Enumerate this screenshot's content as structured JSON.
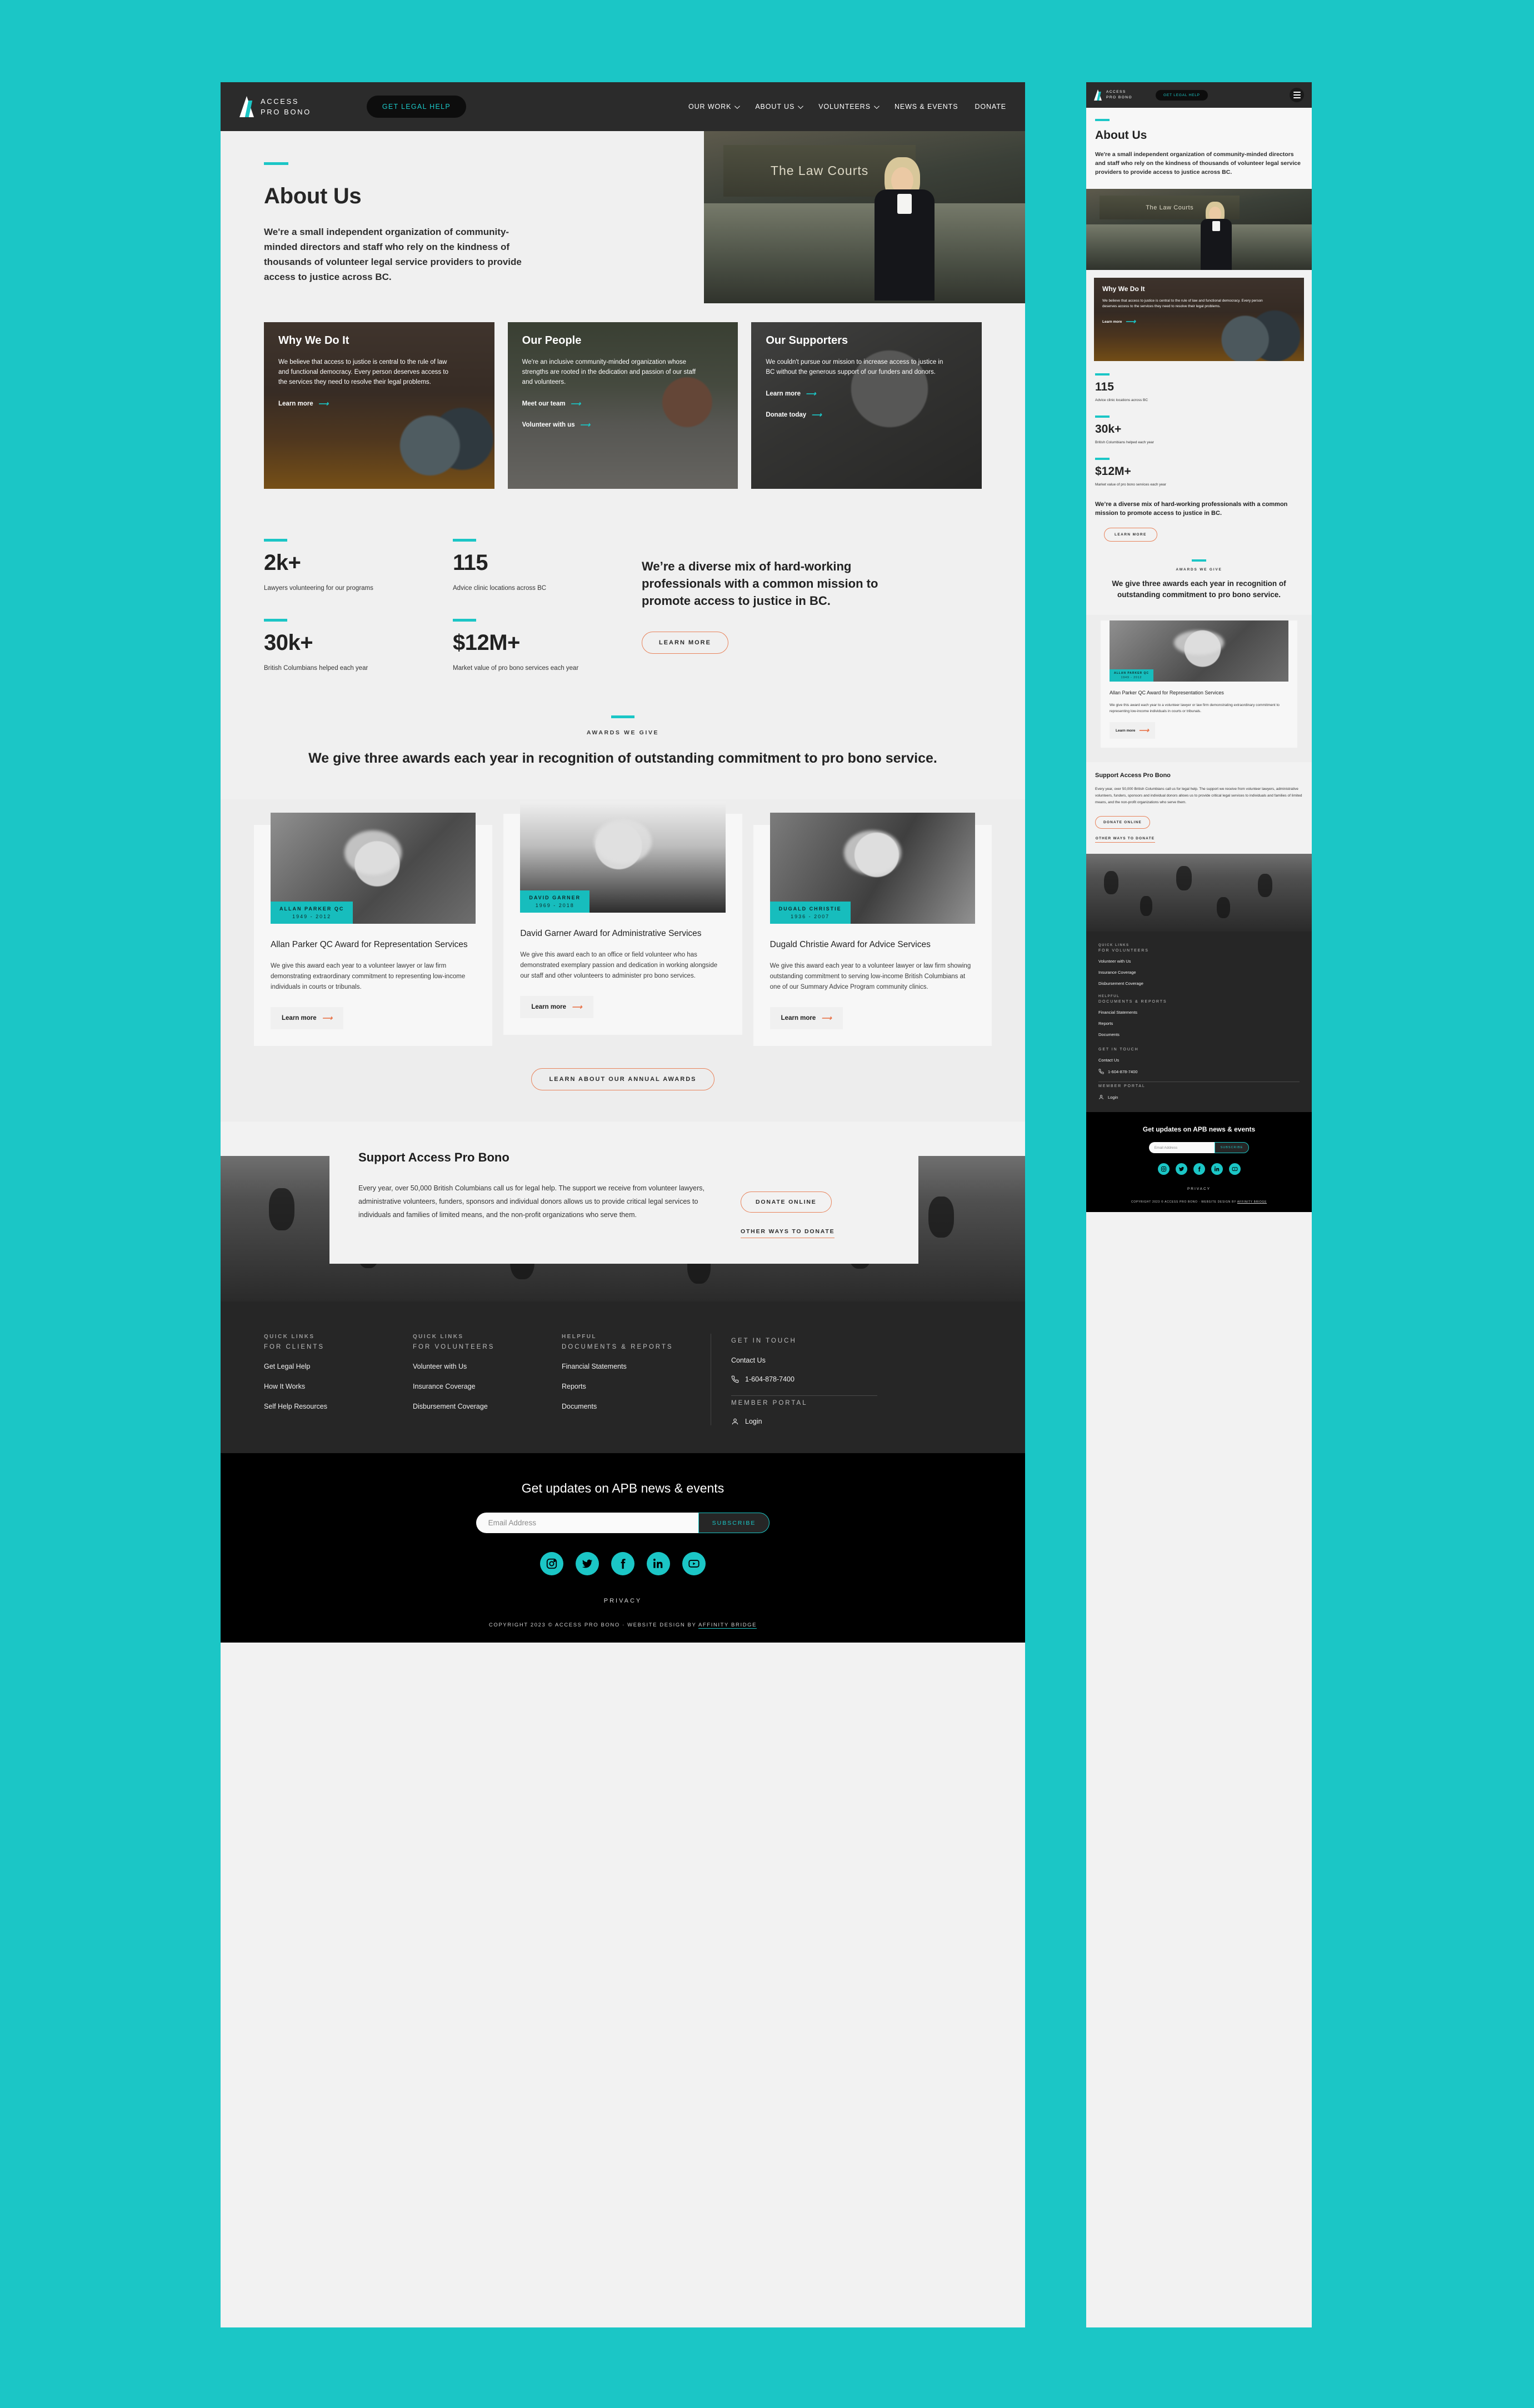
{
  "brand": {
    "name_line1": "ACCESS",
    "name_line2": "PRO BONO",
    "accent": "#1BC6C6",
    "orange": "#E8835B",
    "dark": "#262626"
  },
  "header": {
    "cta": "GET LEGAL HELP",
    "nav": [
      {
        "label": "OUR WORK",
        "caret": true
      },
      {
        "label": "ABOUT US",
        "caret": true
      },
      {
        "label": "VOLUNTEERS",
        "caret": true
      },
      {
        "label": "NEWS & EVENTS",
        "caret": false
      },
      {
        "label": "DONATE",
        "caret": false
      }
    ],
    "menu_icon": "hamburger-icon"
  },
  "hero": {
    "title": "About Us",
    "body": "We're a small independent organization of community-minded directors and staff who rely on the kindness of thousands of volunteer legal service providers to provide access to justice across BC.",
    "image_caption": "The Law Courts"
  },
  "promos": [
    {
      "title": "Why We Do It",
      "body": "We believe that access to justice is central to the rule of law and functional democracy. Every person deserves access to the services they need to resolve their legal problems.",
      "links": [
        "Learn more"
      ]
    },
    {
      "title": "Our People",
      "body": "We're an inclusive community-minded organization whose strengths are rooted in the dedication and passion of our staff and volunteers.",
      "links": [
        "Meet our team",
        "Volunteer with us"
      ]
    },
    {
      "title": "Our Supporters",
      "body": "We couldn't pursue our mission to increase access to justice in BC without the generous support of our funders and donors.",
      "links": [
        "Learn more",
        "Donate today"
      ]
    }
  ],
  "stats": [
    {
      "value": "2k+",
      "label": "Lawyers volunteering for our programs"
    },
    {
      "value": "115",
      "label": "Advice clinic locations across BC"
    },
    {
      "value": "30k+",
      "label": "British Columbians helped each year"
    },
    {
      "value": "$12M+",
      "label": "Market value of pro bono services each year"
    }
  ],
  "stats_lead": {
    "text": "We’re a diverse mix of hard-working professionals with a common mission to promote access to justice in BC.",
    "button": "LEARN MORE"
  },
  "awards_intro": {
    "eyebrow": "AWARDS WE GIVE",
    "heading": "We give three awards each year in recognition of outstanding commitment to pro bono service."
  },
  "awards": [
    {
      "tag_name": "ALLAN PARKER QC",
      "tag_years": "1949 - 2012",
      "title": "Allan Parker QC Award for Representation Services",
      "body": "We give this award each year to a volunteer lawyer or law firm demonstrating extraordinary commitment to representing low-income individuals in courts or tribunals.",
      "link": "Learn more"
    },
    {
      "tag_name": "DAVID GARNER",
      "tag_years": "1969 - 2018",
      "title": "David Garner Award for Administrative Services",
      "body": "We give this award each to an office or field volunteer who has demonstrated exemplary passion and dedication in working alongside our staff and other volunteers to administer pro bono services.",
      "link": "Learn more"
    },
    {
      "tag_name": "DUGALD CHRISTIE",
      "tag_years": "1936 - 2007",
      "title": "Dugald Christie Award for Advice Services",
      "body": "We give this award each year to a volunteer lawyer or law firm showing outstanding commitment to serving low-income British Columbians at one of our Summary Advice Program community clinics.",
      "link": "Learn more"
    }
  ],
  "annual_button": "LEARN ABOUT OUR ANNUAL AWARDS",
  "support": {
    "title": "Support Access Pro Bono",
    "body": "Every year, over 50,000 British Columbians call us for legal help. The support we receive from volunteer lawyers, administrative volunteers, funders, sponsors and individual donors allows us to provide critical legal services to individuals and families of limited means, and the non-profit organizations who serve them.",
    "donate_button": "DONATE ONLINE",
    "other_ways": "OTHER WAYS TO DONATE"
  },
  "footer": {
    "columns": [
      {
        "head": "QUICK LINKS",
        "head2": "FOR CLIENTS",
        "links": [
          "Get Legal Help",
          "How It Works",
          "Self Help Resources"
        ]
      },
      {
        "head": "QUICK LINKS",
        "head2": "FOR VOLUNTEERS",
        "links": [
          "Volunteer with Us",
          "Insurance Coverage",
          "Disbursement Coverage"
        ]
      },
      {
        "head": "HELPFUL",
        "head2": "DOCUMENTS & REPORTS",
        "links": [
          "Financial Statements",
          "Reports",
          "Documents"
        ]
      }
    ],
    "get_in_touch": {
      "head": "GET IN TOUCH",
      "contact": "Contact Us",
      "phone": "1-604-878-7400",
      "phone_icon": "phone-icon"
    },
    "member_portal": {
      "head": "MEMBER PORTAL",
      "login": "Login",
      "login_icon": "user-icon"
    }
  },
  "newsletter": {
    "heading": "Get updates on APB news & events",
    "placeholder": "Email Address",
    "value": "",
    "subscribe": "SUBSCRIBE",
    "socials": [
      "instagram-icon",
      "twitter-icon",
      "facebook-icon",
      "linkedin-icon",
      "youtube-icon"
    ],
    "privacy": "PRIVACY",
    "copyright_prefix": "COPYRIGHT 2023 © ACCESS PRO BONO · WEBSITE DESIGN BY ",
    "copyright_link": "AFFINITY BRIDGE"
  }
}
